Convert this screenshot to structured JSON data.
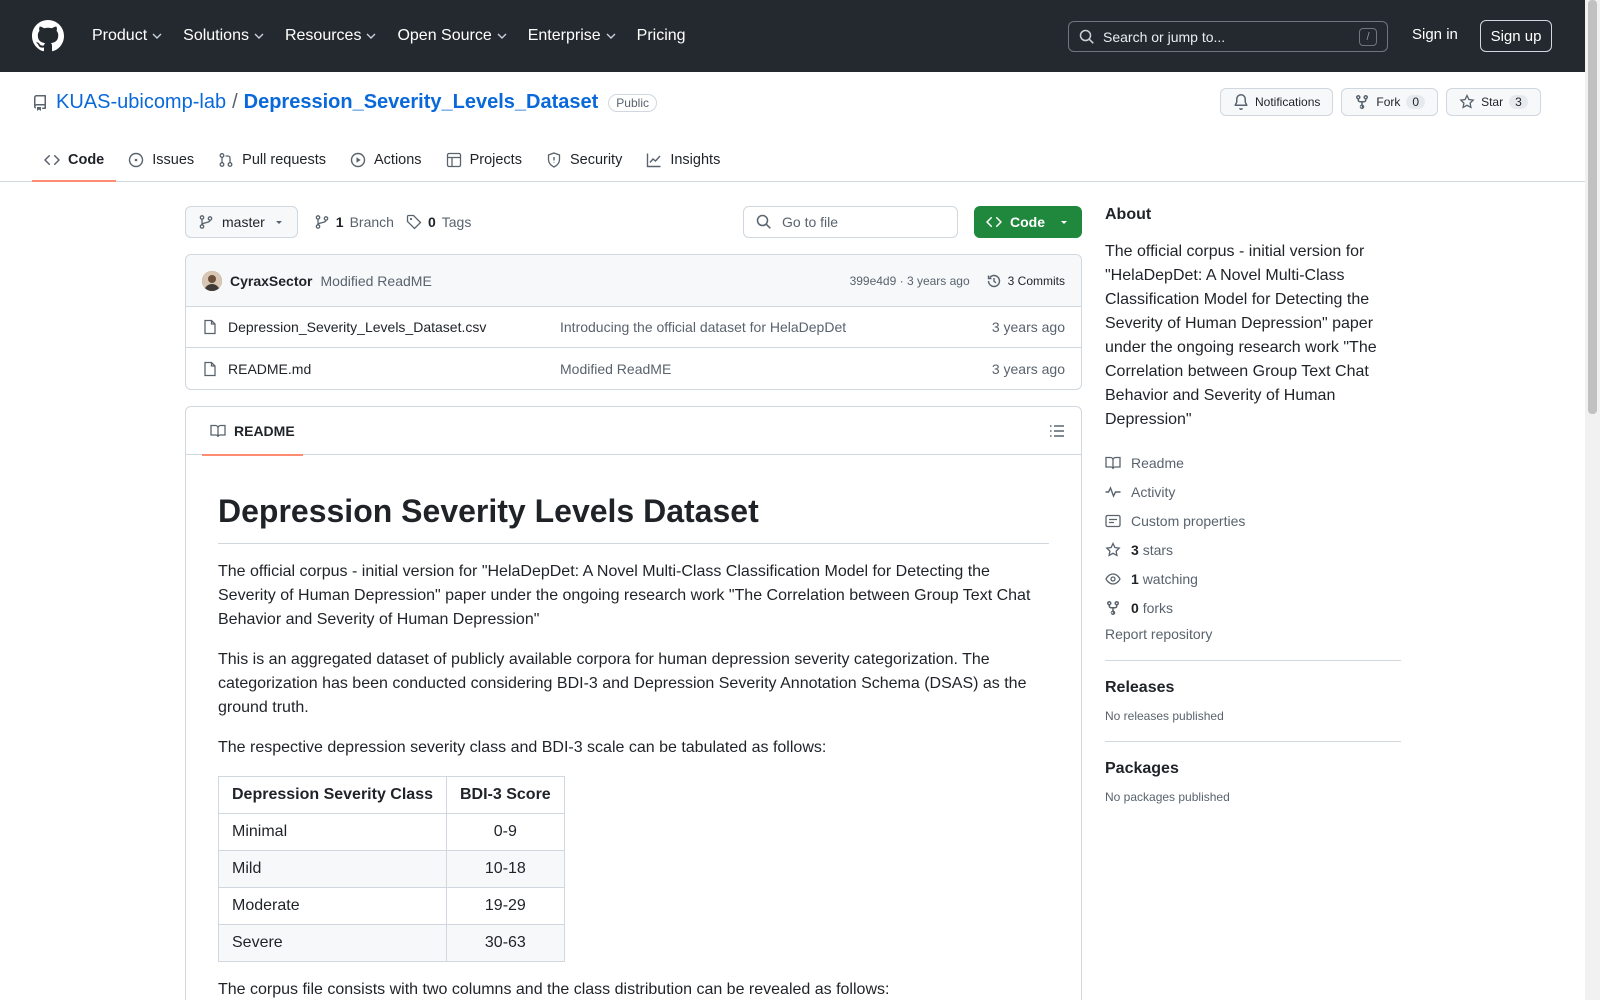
{
  "header": {
    "nav": [
      "Product",
      "Solutions",
      "Resources",
      "Open Source",
      "Enterprise",
      "Pricing"
    ],
    "search_placeholder": "Search or jump to...",
    "slash_key": "/",
    "sign_in": "Sign in",
    "sign_up": "Sign up"
  },
  "repo": {
    "owner": "KUAS-ubicomp-lab",
    "separator": "/",
    "name": "Depression_Severity_Levels_Dataset",
    "visibility": "Public",
    "notifications_label": "Notifications",
    "fork_label": "Fork",
    "fork_count": "0",
    "star_label": "Star",
    "star_count": "3",
    "tabs": [
      "Code",
      "Issues",
      "Pull requests",
      "Actions",
      "Projects",
      "Security",
      "Insights"
    ]
  },
  "toolbar": {
    "branch": "master",
    "branch_count": "1",
    "branch_label": "Branch",
    "tag_count": "0",
    "tag_label": "Tags",
    "goto_placeholder": "Go to file",
    "code_label": "Code"
  },
  "commit": {
    "author": "CyraxSector",
    "message": "Modified ReadME",
    "hash_time": "399e4d9 · 3 years ago",
    "commits_label": "3 Commits"
  },
  "files": [
    {
      "name": "Depression_Severity_Levels_Dataset.csv",
      "message": "Introducing the official dataset for HelaDepDet",
      "time": "3 years ago"
    },
    {
      "name": "README.md",
      "message": "Modified ReadME",
      "time": "3 years ago"
    }
  ],
  "readme": {
    "tab_label": "README",
    "title": "Depression Severity Levels Dataset",
    "p1": "The official corpus - initial version for \"HelaDepDet: A Novel Multi-Class Classification Model for Detecting the Severity of Human Depression\" paper under the ongoing research work \"The Correlation between Group Text Chat Behavior and Severity of Human Depression\"",
    "p2": "This is an aggregated dataset of publicly available corpora for human depression severity categorization. The categorization has been conducted considering BDI-3 and Depression Severity Annotation Schema (DSAS) as the ground truth.",
    "p3": "The respective depression severity class and BDI-3 scale can be tabulated as follows:",
    "table_headers": [
      "Depression Severity Class",
      "BDI-3 Score"
    ],
    "table_rows": [
      [
        "Minimal",
        "0-9"
      ],
      [
        "Mild",
        "10-18"
      ],
      [
        "Moderate",
        "19-29"
      ],
      [
        "Severe",
        "30-63"
      ]
    ],
    "p4": "The corpus file consists with two columns and the class distribution can be revealed as follows:"
  },
  "about": {
    "title": "About",
    "description": "The official corpus - initial version for \"HelaDepDet: A Novel Multi-Class Classification Model for Detecting the Severity of Human Depression\" paper under the ongoing research work \"The Correlation between Group Text Chat Behavior and Severity of Human Depression\"",
    "readme": "Readme",
    "activity": "Activity",
    "custom_properties": "Custom properties",
    "stars_count": "3",
    "stars_label": "stars",
    "watching_count": "1",
    "watching_label": "watching",
    "forks_count": "0",
    "forks_label": "forks",
    "report": "Report repository"
  },
  "releases": {
    "title": "Releases",
    "empty": "No releases published"
  },
  "packages": {
    "title": "Packages",
    "empty": "No packages published"
  },
  "colors": {
    "accent_link": "#0969da",
    "primary_button": "#1f883d",
    "header_bg": "#24292f",
    "tab_underline": "#fd8c73"
  }
}
